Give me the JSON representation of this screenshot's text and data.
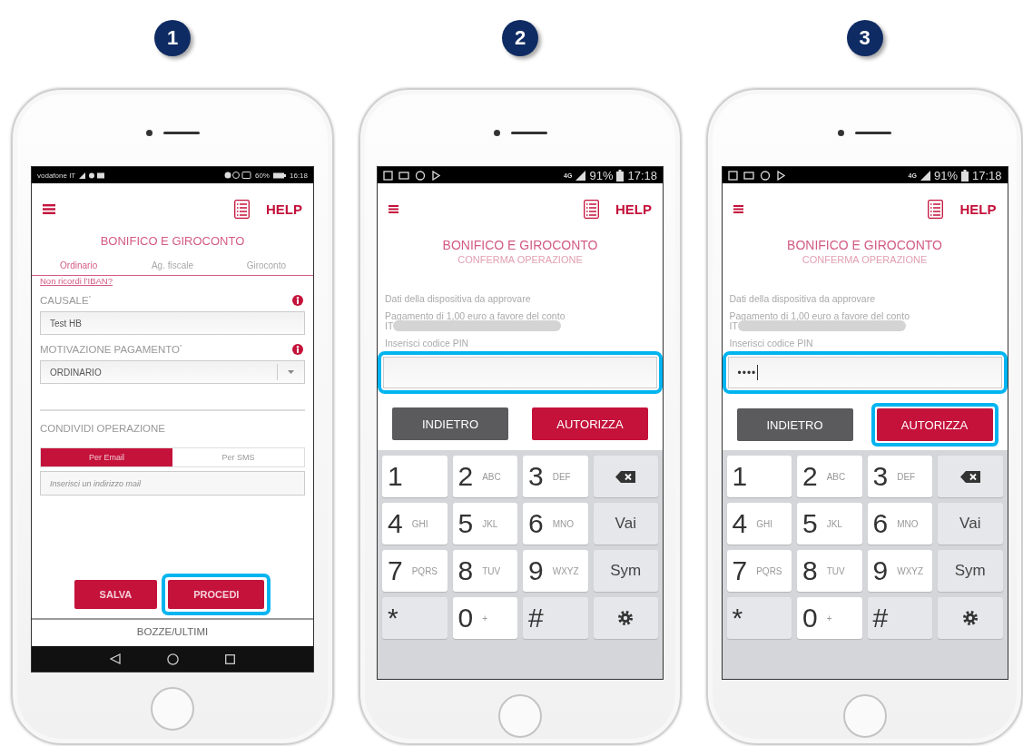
{
  "steps": [
    {
      "number": "1",
      "screen": {
        "kind": "form",
        "status": {
          "carrier": "vodafone IT",
          "battery": "60%",
          "time": "16:18"
        },
        "help": "HELP",
        "title": "BONIFICO E GIROCONTO",
        "tabs": [
          {
            "label": "Ordinario",
            "selected": true
          },
          {
            "label": "Ag. fiscale",
            "selected": false
          },
          {
            "label": "Giroconto",
            "selected": false
          }
        ],
        "link": "Non ricordi l'IBAN?",
        "fields": [
          {
            "kind": "text",
            "label": "CAUSALE$^{*}$",
            "value": "Test HB"
          },
          {
            "kind": "dropdown",
            "label": "MOTIVAZIONE PAGAMENTO$^{*}$",
            "value": "ORDINARIO"
          }
        ],
        "section": "CONDIVIDI OPERAZIONE",
        "share_tabs": [
          {
            "label": "Per Email",
            "selected": true
          },
          {
            "label": "Per SMS",
            "selected": false
          }
        ],
        "email_placeholder": "Inserisci un indirizzo mail",
        "buttons": [
          {
            "label": "SALVA",
            "highlighted": false
          },
          {
            "label": "PROCEDI",
            "highlighted": true
          }
        ],
        "footer": "BOZZE/ULTIMI"
      }
    },
    {
      "number": "2",
      "screen": {
        "kind": "pin",
        "status": {
          "network": "4G",
          "battery": "91%",
          "time": "17:18"
        },
        "help": "HELP",
        "title": "BONIFICO E GIROCONTO",
        "subtitle": "CONFERMA OPERAZIONE",
        "info": "Dati della dispositiva da approvare",
        "payment": "Pagamento di 1,00 euro a favore del conto",
        "iban": "IT",
        "pin_label": "Inserisci codice PIN",
        "pin_highlighted": true,
        "buttons": [
          {
            "kind": "back",
            "label": "INDIETRO",
            "highlighted": false
          },
          {
            "kind": "confirm",
            "label": "AUTORIZZA",
            "highlighted": false
          }
        ],
        "keypad": [
          [
            {
              "kind": "digit",
              "main": "1"
            },
            {
              "kind": "digit",
              "main": "2",
              "sub": "ABC"
            },
            {
              "kind": "digit",
              "main": "3",
              "sub": "DEF"
            },
            {
              "kind": "backspace"
            }
          ],
          [
            {
              "kind": "digit",
              "main": "4",
              "sub": "GHI"
            },
            {
              "kind": "digit",
              "main": "5",
              "sub": "JKL"
            },
            {
              "kind": "digit",
              "main": "6",
              "sub": "MNO"
            },
            {
              "kind": "action",
              "main": "Vai"
            }
          ],
          [
            {
              "kind": "digit",
              "main": "7",
              "sub": "PQRS"
            },
            {
              "kind": "digit",
              "main": "8",
              "sub": "TUV"
            },
            {
              "kind": "digit",
              "main": "9",
              "sub": "WXYZ"
            },
            {
              "kind": "action",
              "main": "Sym"
            }
          ],
          [
            {
              "kind": "symbol",
              "main": "*"
            },
            {
              "kind": "digit",
              "main": "0",
              "sub": "+"
            },
            {
              "kind": "symbol",
              "main": "#"
            },
            {
              "kind": "settings"
            }
          ]
        ]
      }
    },
    {
      "number": "3",
      "screen": {
        "kind": "pin",
        "status": {
          "network": "4G",
          "battery": "91%",
          "time": "17:18"
        },
        "help": "HELP",
        "title": "BONIFICO E GIROCONTO",
        "subtitle": "CONFERMA OPERAZIONE",
        "info": "Dati della dispositiva da approvare",
        "payment": "Pagamento di 1,00 euro a favore del conto",
        "iban": "IT",
        "pin_label": "Inserisci codice PIN",
        "pin_value": "••••",
        "pin_highlighted": true,
        "buttons": [
          {
            "kind": "back",
            "label": "INDIETRO",
            "highlighted": false
          },
          {
            "kind": "confirm",
            "label": "AUTORIZZA",
            "highlighted": true
          }
        ],
        "keypad": [
          [
            {
              "kind": "digit",
              "main": "1"
            },
            {
              "kind": "digit",
              "main": "2",
              "sub": "ABC"
            },
            {
              "kind": "digit",
              "main": "3",
              "sub": "DEF"
            },
            {
              "kind": "backspace"
            }
          ],
          [
            {
              "kind": "digit",
              "main": "4",
              "sub": "GHI"
            },
            {
              "kind": "digit",
              "main": "5",
              "sub": "JKL"
            },
            {
              "kind": "digit",
              "main": "6",
              "sub": "MNO"
            },
            {
              "kind": "action",
              "main": "Vai"
            }
          ],
          [
            {
              "kind": "digit",
              "main": "7",
              "sub": "PQRS"
            },
            {
              "kind": "digit",
              "main": "8",
              "sub": "TUV"
            },
            {
              "kind": "digit",
              "main": "9",
              "sub": "WXYZ"
            },
            {
              "kind": "action",
              "main": "Sym"
            }
          ],
          [
            {
              "kind": "symbol",
              "main": "*"
            },
            {
              "kind": "digit",
              "main": "0",
              "sub": "+"
            },
            {
              "kind": "symbol",
              "main": "#"
            },
            {
              "kind": "settings"
            }
          ]
        ]
      }
    }
  ]
}
